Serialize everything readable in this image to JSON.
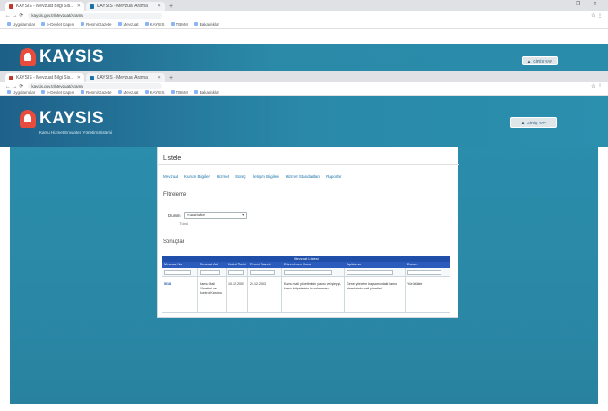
{
  "browser_outer": {
    "tabs": [
      {
        "title": "KAYSIS - Mevzuat Bilgi Sis..."
      },
      {
        "title": "KAYSIS - Mevzuat Arama"
      }
    ],
    "new_tab": "+",
    "window_controls": "–  ❐  ✕",
    "address": "kaysis.gov.tr/Mevzuat/Arama",
    "nav_buttons": "←  →  ⟳",
    "right_icons": "☆  ⋮",
    "bookmarks": [
      "Uygulamalar",
      "e-Devlet Kapısı",
      "Resmi Gazete",
      "Mevzuat",
      "KAYSIS",
      "TBMM",
      "Bakanlıklar"
    ]
  },
  "browser_inner": {
    "tabs": [
      {
        "title": "KAYSIS - Mevzuat Bilgi Sis..."
      },
      {
        "title": "KAYSIS - Mevzuat Arama"
      }
    ],
    "new_tab": "+",
    "window_controls": "–  ❐  ✕",
    "address": "kaysis.gov.tr/Mevzuat/Arama",
    "nav_buttons": "←  →  ⟳",
    "right_icons": "☆  ⋮",
    "bookmarks": [
      "Uygulamalar",
      "e-Devlet Kapısı",
      "Resmi Gazete",
      "Mevzuat",
      "KAYSIS",
      "TBMM",
      "Bakanlıklar"
    ]
  },
  "site": {
    "logo_text": "KAYSIS",
    "logo_subtitle": "Kamu Hizmet Envanteri Yönetim Sistemi",
    "login_label": "GİRİŞ YAP"
  },
  "panel": {
    "title": "Listele",
    "nav": [
      "Mevzuat",
      "Kurum Bilgileri",
      "Hizmet",
      "Süreç",
      "İletişim Bilgileri",
      "Hizmet Standartları",
      "Raporlar"
    ],
    "filter_title": "Filtreleme",
    "filter_label": "Durum",
    "filter_value": "Yürürlükte",
    "filter_hint": "Tümü",
    "results_title": "Sonuçlar",
    "table": {
      "caption": "Mevzuat Listesi",
      "headers": [
        "Mevzuat No",
        "Mevzuat Adı",
        "Kabul Tarihi",
        "Resmi Gazete",
        "Düzenlenen Konu",
        "Açıklama",
        "Durum"
      ],
      "row": {
        "c1": "5018",
        "c2": "Kamu Mali Yönetimi ve Kontrol Kanunu",
        "c3": "10.12.2003",
        "c4": "24.12.2003",
        "c5": "Kamu mali yönetiminin yapısı ve işleyişi, kamu bütçelerinin hazırlanması",
        "c6": "Genel yönetim kapsamındaki kamu idarelerinin mali yönetimi",
        "c7": "Yürürlükte"
      }
    }
  }
}
